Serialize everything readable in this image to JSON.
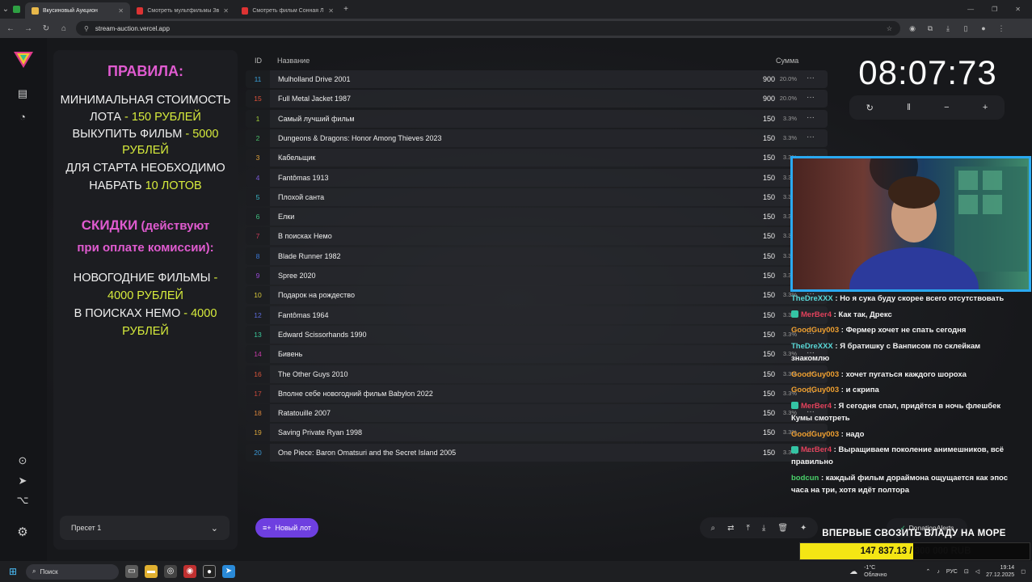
{
  "browser": {
    "tabs": [
      {
        "title": "Вкусиновый Аукцион",
        "active": true,
        "favicon_color": "#e8b84a"
      },
      {
        "title": "Смотреть мультфильмы Звероп",
        "active": false,
        "favicon_color": "#d33"
      },
      {
        "title": "Смотреть фильм Сонная Лощи",
        "active": false,
        "favicon_color": "#d33"
      }
    ],
    "new_tab": "+",
    "url": "stream-auction.vercel.app"
  },
  "rules": {
    "title": "ПРАВИЛА:",
    "line1": "МИНИМАЛЬНАЯ СТОИМОСТЬ",
    "line2a": "ЛОТА",
    "line2b": " - 150 РУБЛЕЙ",
    "line3a": "ВЫКУПИТЬ ФИЛЬМ",
    "line3b": " - 5000",
    "line4": "РУБЛЕЙ",
    "line5": "ДЛЯ СТАРТА НЕОБХОДИМО",
    "line6a": "НАБРАТЬ ",
    "line6b": "10 ЛОТОВ",
    "discount1a": "СКИДКИ",
    "discount1b": " (действуют",
    "discount2": "при оплате комиссии):",
    "ny1a": "НОВОГОДНИЕ ФИЛЬМЫ",
    "ny1b": " -",
    "ny2": "4000 РУБЛЕЙ",
    "nemo1a": "В ПОИСКАХ НЕМО",
    "nemo1b": " - 4000",
    "nemo2": "РУБЛЕЙ"
  },
  "preset": {
    "label": "Пресет 1",
    "chevron": "⌄"
  },
  "table": {
    "headers": {
      "id": "ID",
      "name": "Название",
      "amount": "Сумма"
    },
    "rows": [
      {
        "id": "11",
        "name": "Mulholland Drive 2001",
        "amount": "900",
        "pct": "20.0%",
        "color": "#3aa0d8"
      },
      {
        "id": "15",
        "name": "Full Metal Jacket 1987",
        "amount": "900",
        "pct": "20.0%",
        "color": "#e0523a"
      },
      {
        "id": "1",
        "name": "Самый лучший фильм",
        "amount": "150",
        "pct": "3.3%",
        "color": "#a3d23a"
      },
      {
        "id": "2",
        "name": "Dungeons & Dragons: Honor Among Thieves 2023",
        "amount": "150",
        "pct": "3.3%",
        "color": "#4ac06a"
      },
      {
        "id": "3",
        "name": "Кабельщик",
        "amount": "150",
        "pct": "3.3%",
        "color": "#e0a23a"
      },
      {
        "id": "4",
        "name": "Fantômas 1913",
        "amount": "150",
        "pct": "3.3%",
        "color": "#7a5ad8"
      },
      {
        "id": "5",
        "name": "Плохой санта",
        "amount": "150",
        "pct": "3.3%",
        "color": "#3ab8c8"
      },
      {
        "id": "6",
        "name": "Елки",
        "amount": "150",
        "pct": "3.3%",
        "color": "#40c080"
      },
      {
        "id": "7",
        "name": "В поисках Немо",
        "amount": "150",
        "pct": "3.3%",
        "color": "#c83a5a"
      },
      {
        "id": "8",
        "name": "Blade Runner 1982",
        "amount": "150",
        "pct": "3.3%",
        "color": "#3a78d8"
      },
      {
        "id": "9",
        "name": "Spree 2020",
        "amount": "150",
        "pct": "3.3%",
        "color": "#9a4ad8"
      },
      {
        "id": "10",
        "name": "Подарок на рождество",
        "amount": "150",
        "pct": "3.3%",
        "color": "#d8c83a"
      },
      {
        "id": "12",
        "name": "Fantômas 1964",
        "amount": "150",
        "pct": "3.3%",
        "color": "#5a6ad8"
      },
      {
        "id": "13",
        "name": "Edward Scissorhands 1990",
        "amount": "150",
        "pct": "3.3%",
        "color": "#3ac89a"
      },
      {
        "id": "14",
        "name": "Бивень",
        "amount": "150",
        "pct": "3.3%",
        "color": "#c83aa8"
      },
      {
        "id": "16",
        "name": "The Other Guys 2010",
        "amount": "150",
        "pct": "3.3%",
        "color": "#d8543a"
      },
      {
        "id": "17",
        "name": "Вполне себе новогодний фильм Babylon 2022",
        "amount": "150",
        "pct": "3.3%",
        "color": "#c8483a"
      },
      {
        "id": "18",
        "name": "Ratatouille 2007",
        "amount": "150",
        "pct": "3.3%",
        "color": "#d8843a"
      },
      {
        "id": "19",
        "name": "Saving Private Ryan 1998",
        "amount": "150",
        "pct": "3.3%",
        "color": "#d8a43a"
      },
      {
        "id": "20",
        "name": "One Piece: Baron Omatsuri and the Secret Island 2005",
        "amount": "150",
        "pct": "3.3%",
        "color": "#3a9ad8"
      }
    ],
    "more": "···"
  },
  "new_lot": "Новый лот",
  "timer": {
    "mm": "08",
    "ss": "07",
    "ms": "73",
    "sep": ":"
  },
  "timer_controls": [
    "↻",
    "‖",
    "−",
    "+"
  ],
  "chat": [
    {
      "user": "TheDreXXX",
      "color": "#5ad7d7",
      "badge": false,
      "text": " : Но я сука буду скорее всего отсутствовать"
    },
    {
      "user": "MerBer4",
      "color": "#e0405a",
      "badge": true,
      "text": " : Как так, Дрекс"
    },
    {
      "user": "GoodGuy003",
      "color": "#f0a030",
      "badge": false,
      "text": " : Фермер хочет не спать сегодня"
    },
    {
      "user": "TheDreXXX",
      "color": "#5ad7d7",
      "badge": false,
      "text": " : Я братишку с Ванписом по склейкам",
      "cont": "знакомлю"
    },
    {
      "user": "GoodGuy003",
      "color": "#f0a030",
      "badge": false,
      "text": " : хочет пугаться каждого шороха"
    },
    {
      "user": "GoodGuy003",
      "color": "#f0a030",
      "badge": false,
      "text": " : и скрипа"
    },
    {
      "user": "MerBer4",
      "color": "#e0405a",
      "badge": true,
      "text": " : Я сегодня спал, придётся в ночь флешбек",
      "cont": "Кумы смотреть"
    },
    {
      "user": "GoodGuy003",
      "color": "#f0a030",
      "badge": false,
      "text": " : надо"
    },
    {
      "user": "MerBer4",
      "color": "#e0405a",
      "badge": true,
      "text": " : Выращиваем поколение анимешников, всё",
      "cont": "правильно"
    },
    {
      "user": "bodcun",
      "color": "#4ad06a",
      "badge": false,
      "text": " : каждый фильм дораймона ощущается как эпос",
      "cont": "часа на три, хотя идёт полтора"
    }
  ],
  "donation": {
    "label": "DonationAlerts"
  },
  "goal": {
    "title": "ВПЕРВЫЕ СВОЗИТЬ ВЛАДУ НА МОРЕ",
    "text": "147 837.13 / 300 000 RUB",
    "progress": 0.4928
  },
  "taskbar": {
    "search": "Поиск",
    "weather_temp": "-1°C",
    "weather_desc": "Облачно",
    "lang": "РУС",
    "time": "19:14",
    "date": "27.12.2025"
  }
}
